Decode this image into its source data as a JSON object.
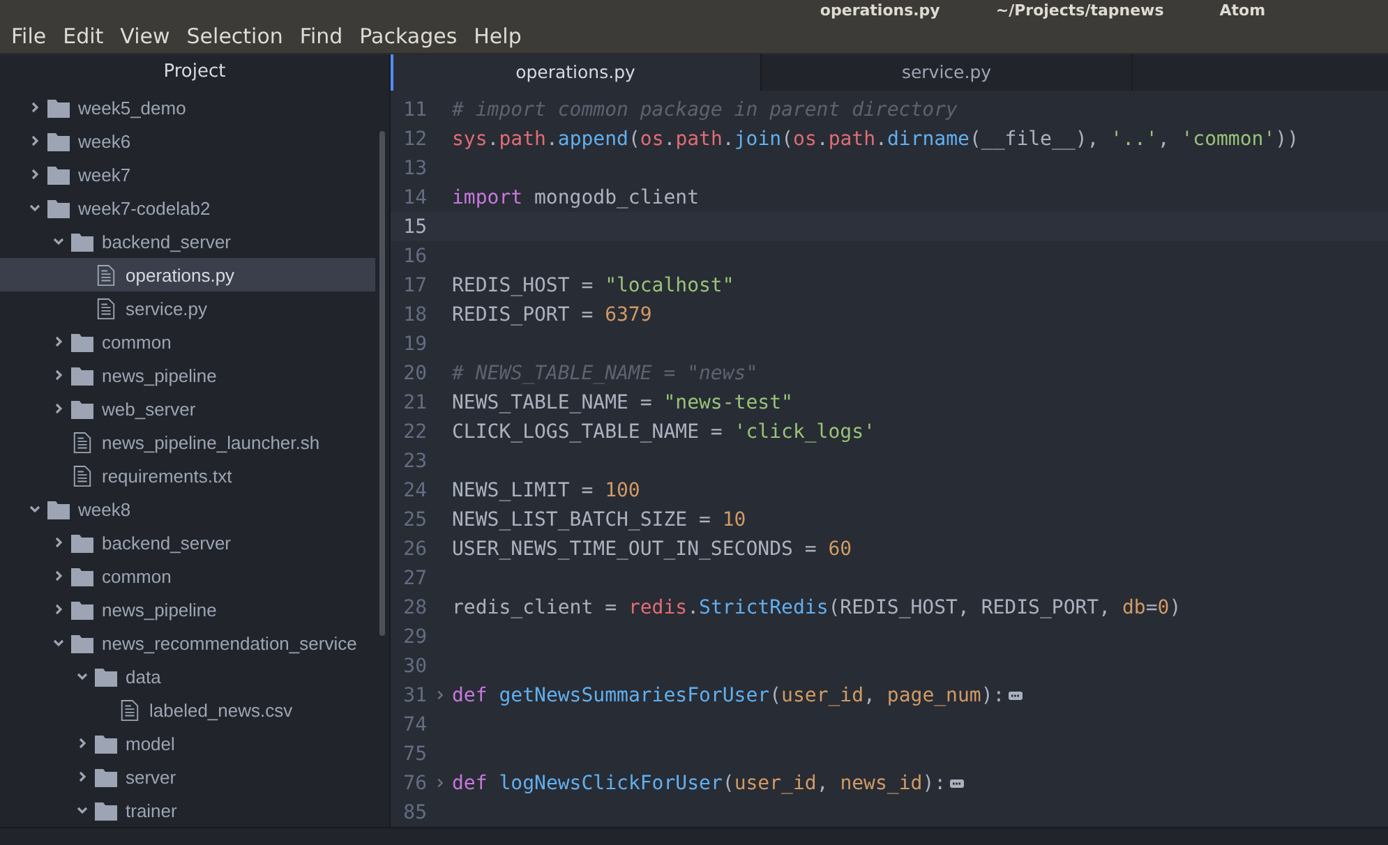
{
  "window": {
    "title": [
      "operations.py",
      "~/Projects/tapnews",
      "Atom"
    ]
  },
  "menu": [
    "File",
    "Edit",
    "View",
    "Selection",
    "Find",
    "Packages",
    "Help"
  ],
  "sidebar": {
    "title": "Project",
    "tree": [
      {
        "kind": "folder",
        "label": "week5_demo",
        "expanded": false,
        "selected": false
      },
      {
        "kind": "folder",
        "label": "week6",
        "expanded": false,
        "selected": false
      },
      {
        "kind": "folder",
        "label": "week7",
        "expanded": false,
        "selected": false
      },
      {
        "kind": "folder",
        "label": "week7-codelab2",
        "expanded": true,
        "selected": false,
        "children": [
          {
            "kind": "folder",
            "label": "backend_server",
            "expanded": true,
            "selected": false,
            "children": [
              {
                "kind": "file",
                "label": "operations.py",
                "selected": true
              },
              {
                "kind": "file",
                "label": "service.py",
                "selected": false
              }
            ]
          },
          {
            "kind": "folder",
            "label": "common",
            "expanded": false,
            "selected": false
          },
          {
            "kind": "folder",
            "label": "news_pipeline",
            "expanded": false,
            "selected": false
          },
          {
            "kind": "folder",
            "label": "web_server",
            "expanded": false,
            "selected": false
          },
          {
            "kind": "file",
            "label": "news_pipeline_launcher.sh",
            "selected": false
          },
          {
            "kind": "file",
            "label": "requirements.txt",
            "selected": false
          }
        ]
      },
      {
        "kind": "folder",
        "label": "week8",
        "expanded": true,
        "selected": false,
        "children": [
          {
            "kind": "folder",
            "label": "backend_server",
            "expanded": false,
            "selected": false
          },
          {
            "kind": "folder",
            "label": "common",
            "expanded": false,
            "selected": false
          },
          {
            "kind": "folder",
            "label": "news_pipeline",
            "expanded": false,
            "selected": false
          },
          {
            "kind": "folder",
            "label": "news_recommendation_service",
            "expanded": true,
            "selected": false,
            "children": [
              {
                "kind": "folder",
                "label": "data",
                "expanded": true,
                "selected": false,
                "children": [
                  {
                    "kind": "file",
                    "label": "labeled_news.csv",
                    "selected": false
                  }
                ]
              },
              {
                "kind": "folder",
                "label": "model",
                "expanded": false,
                "selected": false
              },
              {
                "kind": "folder",
                "label": "server",
                "expanded": false,
                "selected": false
              },
              {
                "kind": "folder",
                "label": "trainer",
                "expanded": true,
                "selected": false
              }
            ]
          }
        ]
      }
    ]
  },
  "tabs": [
    {
      "label": "operations.py",
      "selected": true
    },
    {
      "label": "service.py",
      "selected": false
    }
  ],
  "editor": {
    "lines": [
      {
        "number": "11",
        "current": false,
        "folded": false,
        "tokens": [
          {
            "text": "# import common package in parent directory",
            "kind": "comment"
          }
        ]
      },
      {
        "number": "12",
        "current": false,
        "folded": false,
        "tokens": [
          {
            "text": "sys",
            "kind": "builtin"
          },
          {
            "text": ".",
            "kind": "plain"
          },
          {
            "text": "path",
            "kind": "builtin"
          },
          {
            "text": ".",
            "kind": "plain"
          },
          {
            "text": "append",
            "kind": "function"
          },
          {
            "text": "(",
            "kind": "plain"
          },
          {
            "text": "os",
            "kind": "builtin"
          },
          {
            "text": ".",
            "kind": "plain"
          },
          {
            "text": "path",
            "kind": "builtin"
          },
          {
            "text": ".",
            "kind": "plain"
          },
          {
            "text": "join",
            "kind": "function"
          },
          {
            "text": "(",
            "kind": "plain"
          },
          {
            "text": "os",
            "kind": "builtin"
          },
          {
            "text": ".",
            "kind": "plain"
          },
          {
            "text": "path",
            "kind": "builtin"
          },
          {
            "text": ".",
            "kind": "plain"
          },
          {
            "text": "dirname",
            "kind": "function"
          },
          {
            "text": "(__file__), ",
            "kind": "plain"
          },
          {
            "text": "'..'",
            "kind": "string"
          },
          {
            "text": ", ",
            "kind": "plain"
          },
          {
            "text": "'common'",
            "kind": "string"
          },
          {
            "text": "))",
            "kind": "plain"
          }
        ]
      },
      {
        "number": "13",
        "current": false,
        "folded": false
      },
      {
        "number": "14",
        "current": false,
        "folded": false,
        "tokens": [
          {
            "text": "import",
            "kind": "keyword"
          },
          {
            "text": " mongodb_client",
            "kind": "plain"
          }
        ]
      },
      {
        "number": "15",
        "current": true,
        "folded": false
      },
      {
        "number": "16",
        "current": false,
        "folded": false
      },
      {
        "number": "17",
        "current": false,
        "folded": false,
        "tokens": [
          {
            "text": "REDIS_HOST = ",
            "kind": "plain"
          },
          {
            "text": "\"localhost\"",
            "kind": "string"
          }
        ]
      },
      {
        "number": "18",
        "current": false,
        "folded": false,
        "tokens": [
          {
            "text": "REDIS_PORT = ",
            "kind": "plain"
          },
          {
            "text": "6379",
            "kind": "number"
          }
        ]
      },
      {
        "number": "19",
        "current": false,
        "folded": false
      },
      {
        "number": "20",
        "current": false,
        "folded": false,
        "tokens": [
          {
            "text": "# NEWS_TABLE_NAME = \"news\"",
            "kind": "comment"
          }
        ]
      },
      {
        "number": "21",
        "current": false,
        "folded": false,
        "tokens": [
          {
            "text": "NEWS_TABLE_NAME = ",
            "kind": "plain"
          },
          {
            "text": "\"news-test\"",
            "kind": "string"
          }
        ]
      },
      {
        "number": "22",
        "current": false,
        "folded": false,
        "tokens": [
          {
            "text": "CLICK_LOGS_TABLE_NAME = ",
            "kind": "plain"
          },
          {
            "text": "'click_logs'",
            "kind": "string"
          }
        ]
      },
      {
        "number": "23",
        "current": false,
        "folded": false
      },
      {
        "number": "24",
        "current": false,
        "folded": false,
        "tokens": [
          {
            "text": "NEWS_LIMIT = ",
            "kind": "plain"
          },
          {
            "text": "100",
            "kind": "number"
          }
        ]
      },
      {
        "number": "25",
        "current": false,
        "folded": false,
        "tokens": [
          {
            "text": "NEWS_LIST_BATCH_SIZE = ",
            "kind": "plain"
          },
          {
            "text": "10",
            "kind": "number"
          }
        ]
      },
      {
        "number": "26",
        "current": false,
        "folded": false,
        "tokens": [
          {
            "text": "USER_NEWS_TIME_OUT_IN_SECONDS = ",
            "kind": "plain"
          },
          {
            "text": "60",
            "kind": "number"
          }
        ]
      },
      {
        "number": "27",
        "current": false,
        "folded": false
      },
      {
        "number": "28",
        "current": false,
        "folded": false,
        "tokens": [
          {
            "text": "redis_client = ",
            "kind": "plain"
          },
          {
            "text": "redis",
            "kind": "builtin"
          },
          {
            "text": ".",
            "kind": "plain"
          },
          {
            "text": "StrictRedis",
            "kind": "function"
          },
          {
            "text": "(REDIS_HOST, REDIS_PORT, ",
            "kind": "plain"
          },
          {
            "text": "db",
            "kind": "number"
          },
          {
            "text": "=",
            "kind": "plain"
          },
          {
            "text": "0",
            "kind": "number"
          },
          {
            "text": ")",
            "kind": "plain"
          }
        ]
      },
      {
        "number": "29",
        "current": false,
        "folded": false
      },
      {
        "number": "30",
        "current": false,
        "folded": false
      },
      {
        "number": "31",
        "current": false,
        "folded": true,
        "tokens": [
          {
            "text": "def",
            "kind": "keyword"
          },
          {
            "text": " getNewsSummariesForUser",
            "kind": "function"
          },
          {
            "text": "(",
            "kind": "plain"
          },
          {
            "text": "user_id",
            "kind": "number"
          },
          {
            "text": ", ",
            "kind": "plain"
          },
          {
            "text": "page_num",
            "kind": "number"
          },
          {
            "text": "):",
            "kind": "plain"
          }
        ]
      },
      {
        "number": "74",
        "current": false,
        "folded": false
      },
      {
        "number": "75",
        "current": false,
        "folded": false
      },
      {
        "number": "76",
        "current": false,
        "folded": true,
        "tokens": [
          {
            "text": "def",
            "kind": "keyword"
          },
          {
            "text": " logNewsClickForUser",
            "kind": "function"
          },
          {
            "text": "(",
            "kind": "plain"
          },
          {
            "text": "user_id",
            "kind": "number"
          },
          {
            "text": ", ",
            "kind": "plain"
          },
          {
            "text": "news_id",
            "kind": "number"
          },
          {
            "text": "):",
            "kind": "plain"
          }
        ]
      },
      {
        "number": "85",
        "current": false,
        "folded": false
      }
    ]
  }
}
